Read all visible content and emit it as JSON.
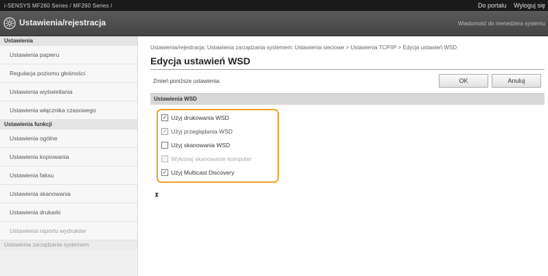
{
  "topbar": {
    "model": "i-SENSYS     MF260 Series / MF260 Series /",
    "portal_link": "Do portalu",
    "logout_link": "Wyloguj się"
  },
  "header": {
    "title": "Ustawienia/rejestracja",
    "message": "Wiadomość do menedżera systemu"
  },
  "sidebar": {
    "sections": [
      {
        "label": "Ustawienia",
        "items": [
          "Ustawienia papieru",
          "Regulacja poziomu głośności",
          "Ustawienia wyświetlania",
          "Ustawienia włącznika czasowego"
        ]
      },
      {
        "label": "Ustawienia funkcji",
        "items": [
          "Ustawienia ogólne",
          "Ustawienia kopiowania",
          "Ustawienia faksu",
          "Ustawienia skanowania",
          "Ustawienia drukarki",
          "Ustawienia raportu wydruków"
        ]
      },
      {
        "label": "Ustawienia zarządzania systemem",
        "items": []
      }
    ]
  },
  "main": {
    "breadcrumb": "Ustawienia/rejestracja: Ustawienia zarządzania systemem: Ustawienia sieciowe > Ustawienia TCP/IP > Edycja ustawień WSD",
    "title": "Edycja ustawień WSD",
    "note": "Zmień poniższe ustawienia.",
    "ok_label": "OK",
    "cancel_label": "Anuluj",
    "settings_header": "Ustawienia WSD",
    "options": [
      {
        "label": "Użyj drukowania WSD",
        "checked": true,
        "disabled": false
      },
      {
        "label": "Użyj przeglądania WSD",
        "checked": true,
        "disabled": true
      },
      {
        "label": "Użyj skanowania WSD",
        "checked": false,
        "disabled": false
      },
      {
        "label": "Wykonaj skanowanie komputer",
        "checked": false,
        "disabled": true
      },
      {
        "label": "Użyj Multicast Discovery",
        "checked": true,
        "disabled": false
      }
    ],
    "to_top": "⧗"
  },
  "colors": {
    "highlight": "#f0a020",
    "header_bg": "#4e4e4e",
    "topbar_bg": "#1a1a1a"
  }
}
